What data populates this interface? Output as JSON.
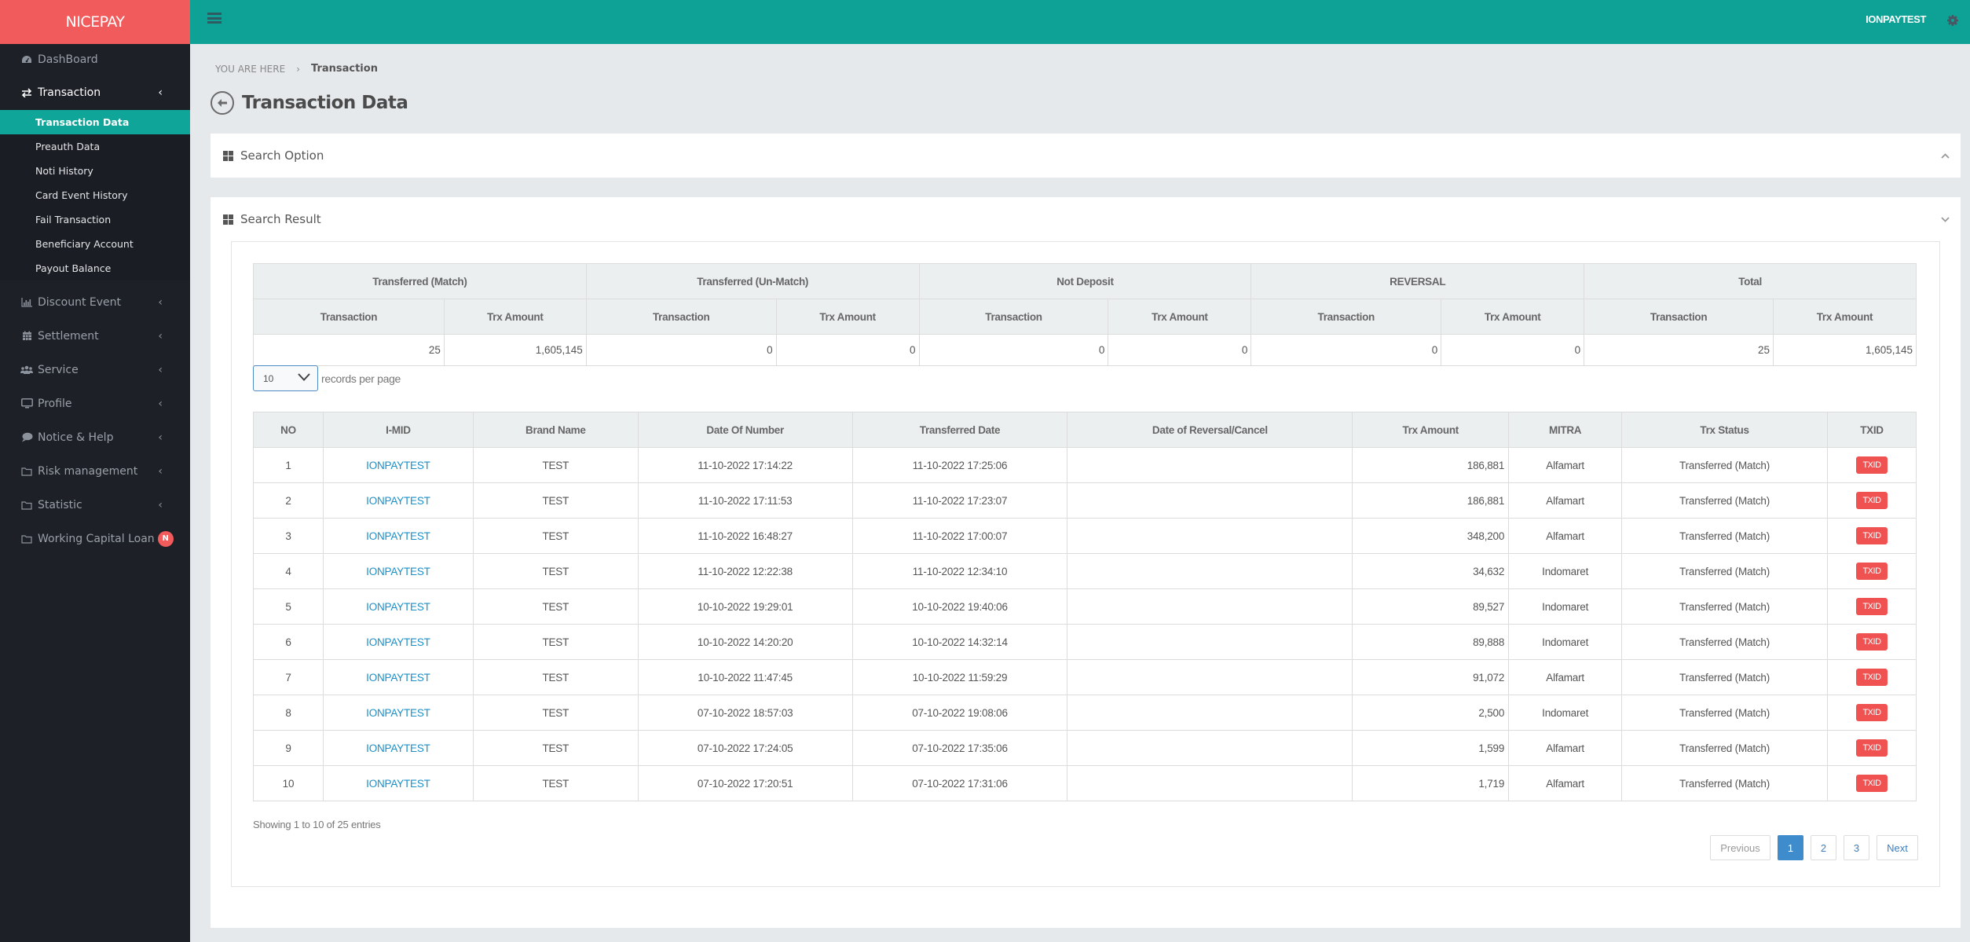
{
  "brand": "NICEPAY",
  "topbar": {
    "user": "IONPAYTEST"
  },
  "sidebar": {
    "dashboard": "DashBoard",
    "transaction": {
      "label": "Transaction",
      "items": [
        "Transaction Data",
        "Preauth Data",
        "Noti History",
        "Card Event History",
        "Fail Transaction",
        "Beneficiary Account",
        "Payout Balance"
      ]
    },
    "items": [
      {
        "label": "Discount Event",
        "icon": "bar-chart-icon"
      },
      {
        "label": "Settlement",
        "icon": "calendar-icon"
      },
      {
        "label": "Service",
        "icon": "users-icon"
      },
      {
        "label": "Profile",
        "icon": "monitor-icon"
      },
      {
        "label": "Notice & Help",
        "icon": "comment-icon"
      },
      {
        "label": "Risk management",
        "icon": "folder-icon"
      },
      {
        "label": "Statistic",
        "icon": "folder-icon"
      },
      {
        "label": "Working Capital Loan",
        "icon": "folder-icon",
        "badge": "N"
      }
    ]
  },
  "breadcrumb": {
    "prefix": "YOU ARE HERE",
    "separator": "›",
    "current": "Transaction"
  },
  "page_title": "Transaction Data",
  "panels": {
    "search_option": "Search Option",
    "search_result": "Search Result"
  },
  "summary": {
    "groups": [
      "Transferred (Match)",
      "Transferred (Un-Match)",
      "Not Deposit",
      "REVERSAL",
      "Total"
    ],
    "sub_headers": [
      "Transaction",
      "Trx Amount"
    ],
    "values": [
      "25",
      "1,605,145",
      "0",
      "0",
      "0",
      "0",
      "0",
      "0",
      "25",
      "1,605,145"
    ]
  },
  "length_menu": {
    "selected": "10",
    "label": "records per page"
  },
  "table": {
    "headers": [
      "NO",
      "I-MID",
      "Brand Name",
      "Date Of Number",
      "Transferred Date",
      "Date of Reversal/Cancel",
      "Trx Amount",
      "MITRA",
      "Trx Status",
      "TXID"
    ],
    "rows": [
      {
        "no": "1",
        "imid": "IONPAYTEST",
        "brand": "TEST",
        "date": "11-10-2022 17:14:22",
        "transferred": "11-10-2022 17:25:06",
        "reversal": "",
        "amount": "186,881",
        "mitra": "Alfamart",
        "status": "Transferred (Match)",
        "txid": "TXID"
      },
      {
        "no": "2",
        "imid": "IONPAYTEST",
        "brand": "TEST",
        "date": "11-10-2022 17:11:53",
        "transferred": "11-10-2022 17:23:07",
        "reversal": "",
        "amount": "186,881",
        "mitra": "Alfamart",
        "status": "Transferred (Match)",
        "txid": "TXID"
      },
      {
        "no": "3",
        "imid": "IONPAYTEST",
        "brand": "TEST",
        "date": "11-10-2022 16:48:27",
        "transferred": "11-10-2022 17:00:07",
        "reversal": "",
        "amount": "348,200",
        "mitra": "Alfamart",
        "status": "Transferred (Match)",
        "txid": "TXID"
      },
      {
        "no": "4",
        "imid": "IONPAYTEST",
        "brand": "TEST",
        "date": "11-10-2022 12:22:38",
        "transferred": "11-10-2022 12:34:10",
        "reversal": "",
        "amount": "34,632",
        "mitra": "Indomaret",
        "status": "Transferred (Match)",
        "txid": "TXID"
      },
      {
        "no": "5",
        "imid": "IONPAYTEST",
        "brand": "TEST",
        "date": "10-10-2022 19:29:01",
        "transferred": "10-10-2022 19:40:06",
        "reversal": "",
        "amount": "89,527",
        "mitra": "Indomaret",
        "status": "Transferred (Match)",
        "txid": "TXID"
      },
      {
        "no": "6",
        "imid": "IONPAYTEST",
        "brand": "TEST",
        "date": "10-10-2022 14:20:20",
        "transferred": "10-10-2022 14:32:14",
        "reversal": "",
        "amount": "89,888",
        "mitra": "Indomaret",
        "status": "Transferred (Match)",
        "txid": "TXID"
      },
      {
        "no": "7",
        "imid": "IONPAYTEST",
        "brand": "TEST",
        "date": "10-10-2022 11:47:45",
        "transferred": "10-10-2022 11:59:29",
        "reversal": "",
        "amount": "91,072",
        "mitra": "Alfamart",
        "status": "Transferred (Match)",
        "txid": "TXID"
      },
      {
        "no": "8",
        "imid": "IONPAYTEST",
        "brand": "TEST",
        "date": "07-10-2022 18:57:03",
        "transferred": "07-10-2022 19:08:06",
        "reversal": "",
        "amount": "2,500",
        "mitra": "Indomaret",
        "status": "Transferred (Match)",
        "txid": "TXID"
      },
      {
        "no": "9",
        "imid": "IONPAYTEST",
        "brand": "TEST",
        "date": "07-10-2022 17:24:05",
        "transferred": "07-10-2022 17:35:06",
        "reversal": "",
        "amount": "1,599",
        "mitra": "Alfamart",
        "status": "Transferred (Match)",
        "txid": "TXID"
      },
      {
        "no": "10",
        "imid": "IONPAYTEST",
        "brand": "TEST",
        "date": "07-10-2022 17:20:51",
        "transferred": "07-10-2022 17:31:06",
        "reversal": "",
        "amount": "1,719",
        "mitra": "Alfamart",
        "status": "Transferred (Match)",
        "txid": "TXID"
      }
    ]
  },
  "info": "Showing 1 to 10 of 25 entries",
  "pagination": {
    "previous": "Previous",
    "pages": [
      "1",
      "2",
      "3"
    ],
    "current": "1",
    "next": "Next"
  },
  "colors": {
    "brand": "#f15b5b",
    "topbar": "#0ea296",
    "active_menu": "#0fa598",
    "link": "#1c8fc7",
    "txid_button": "#f05252",
    "page_active": "#3e8ccc"
  }
}
